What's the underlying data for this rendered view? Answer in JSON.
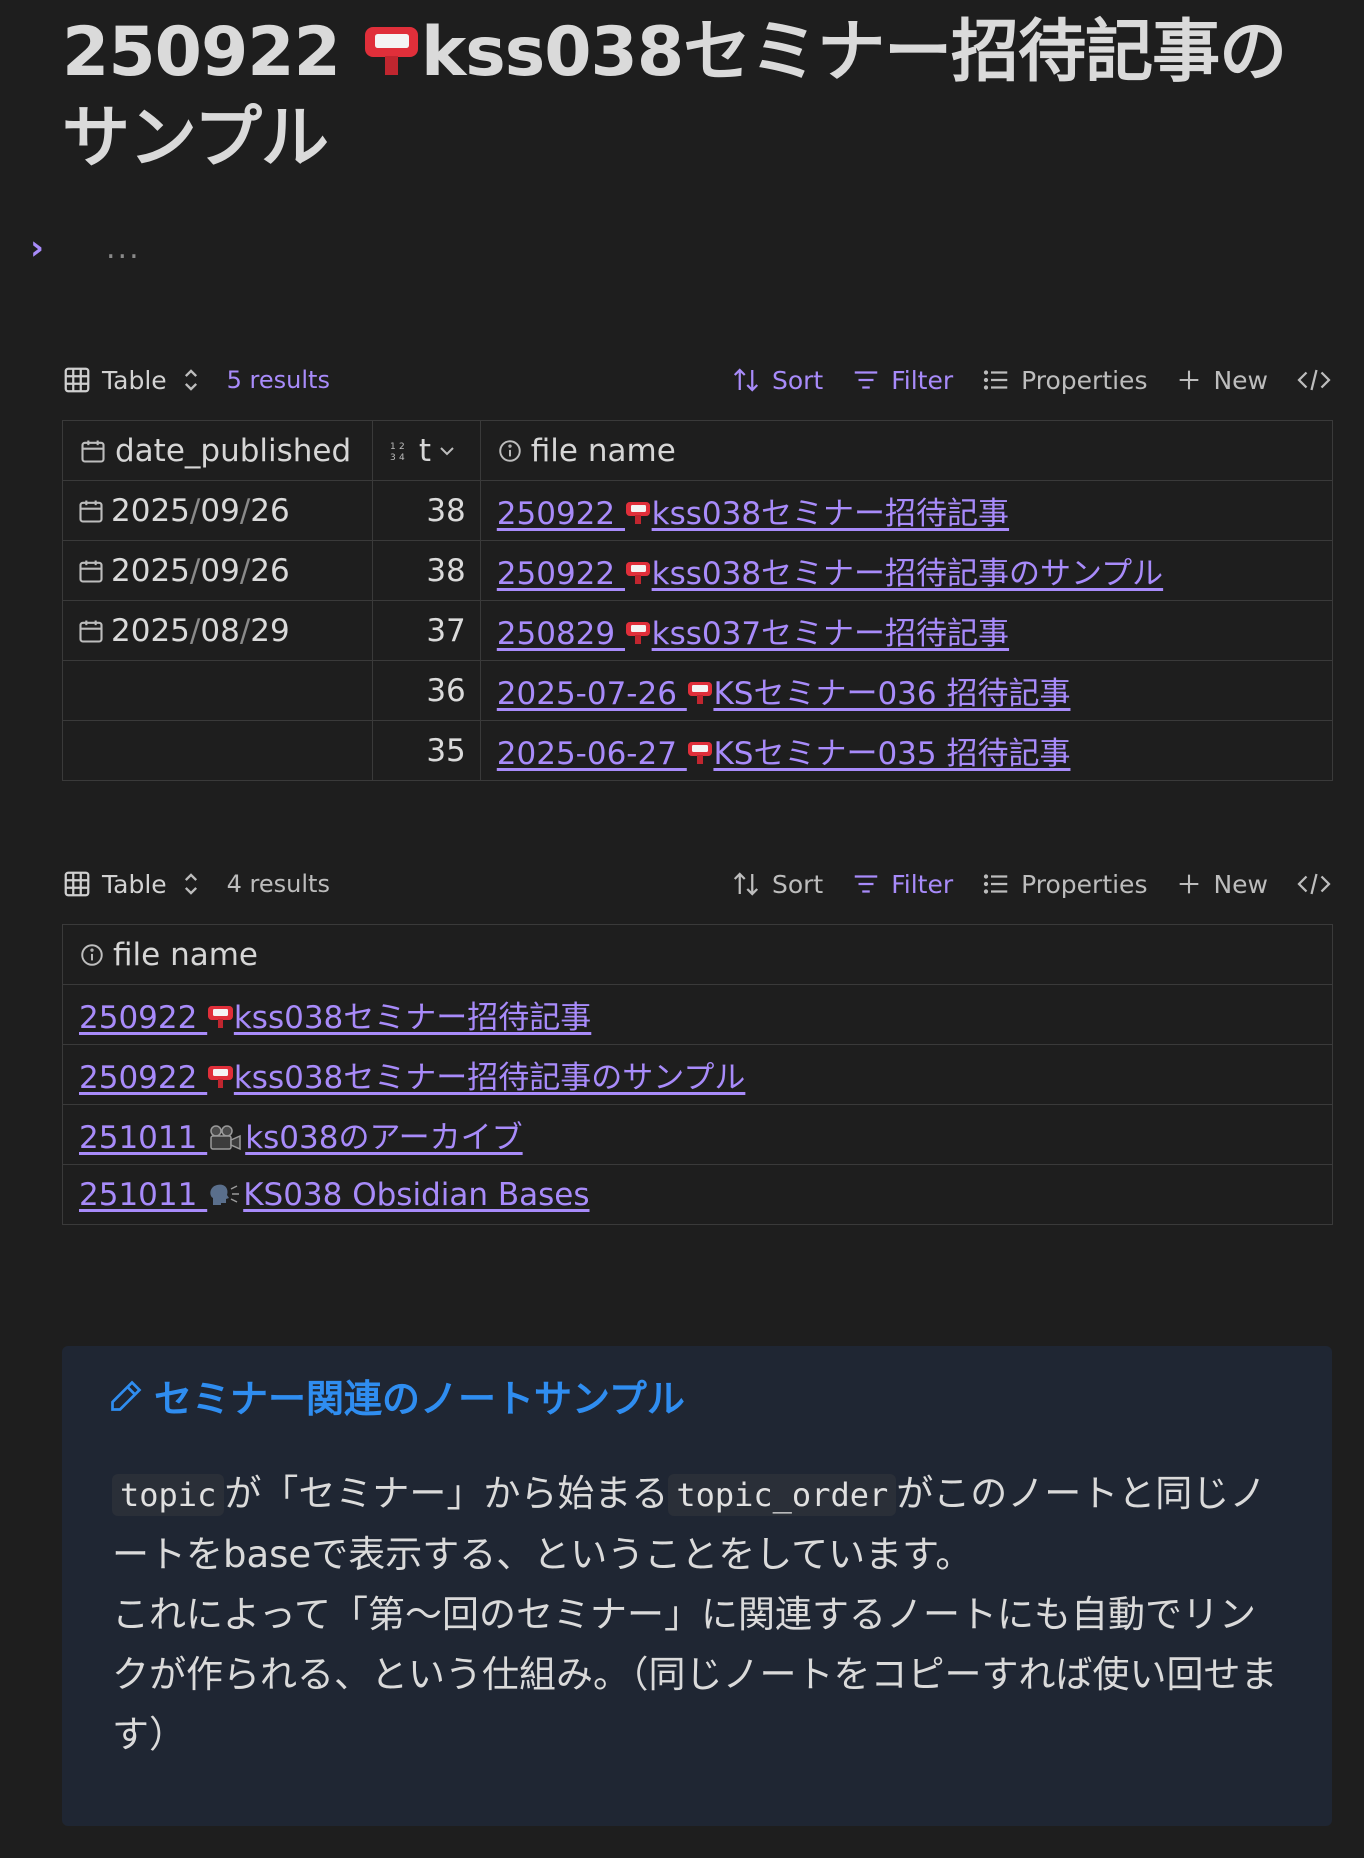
{
  "title": {
    "before": "250922 ",
    "after": "kss038セミナー招待記事のサンプル"
  },
  "collapsed": {
    "ellipsis": "..."
  },
  "base1": {
    "view": "Table",
    "results": "5 results",
    "sort": "Sort",
    "filter": "Filter",
    "properties": "Properties",
    "new": "New",
    "headers": {
      "date": "date_published",
      "order": "t",
      "file": "file name"
    },
    "rows": [
      {
        "y": "2025",
        "m": "09",
        "d": "26",
        "order": "38",
        "file_a": "250922 ",
        "file_b": "kss038セミナー招待記事"
      },
      {
        "y": "2025",
        "m": "09",
        "d": "26",
        "order": "38",
        "file_a": "250922 ",
        "file_b": "kss038セミナー招待記事のサンプル"
      },
      {
        "y": "2025",
        "m": "08",
        "d": "29",
        "order": "37",
        "file_a": "250829 ",
        "file_b": "kss037セミナー招待記事"
      },
      {
        "order": "36",
        "file_a": "2025-07-26 ",
        "file_b": "KSセミナー036 招待記事"
      },
      {
        "order": "35",
        "file_a": "2025-06-27 ",
        "file_b": "KSセミナー035 招待記事"
      }
    ]
  },
  "base2": {
    "view": "Table",
    "results": "4 results",
    "sort": "Sort",
    "filter": "Filter",
    "properties": "Properties",
    "new": "New",
    "headers": {
      "file": "file name"
    },
    "rows": [
      {
        "a": "250922 ",
        "b": "kss038セミナー招待記事",
        "icon": "mailbox"
      },
      {
        "a": "250922 ",
        "b": "kss038セミナー招待記事のサンプル",
        "icon": "mailbox"
      },
      {
        "a": "251011 ",
        "b": "ks038のアーカイブ",
        "icon": "movie-camera"
      },
      {
        "a": "251011 ",
        "b": "KS038 Obsidian Bases",
        "icon": "speaking-head"
      }
    ]
  },
  "callout": {
    "title": "セミナー関連のノートサンプル",
    "code1": "topic",
    "text1": "が「セミナー」から始まる",
    "code2": "topic_order",
    "text2": "がこのノートと同じノートをbaseで表示する、ということをしています。",
    "text3": "これによって「第〜回のセミナー」に関連するノートにも自動でリンクが作られる、という仕組み。（同じノートをコピーすれば使い回せます）"
  },
  "colors": {
    "accent": "#a88bfa",
    "callout_title": "#2f8df0",
    "background": "#1e1e1e",
    "callout_bg": "#1f2633"
  }
}
